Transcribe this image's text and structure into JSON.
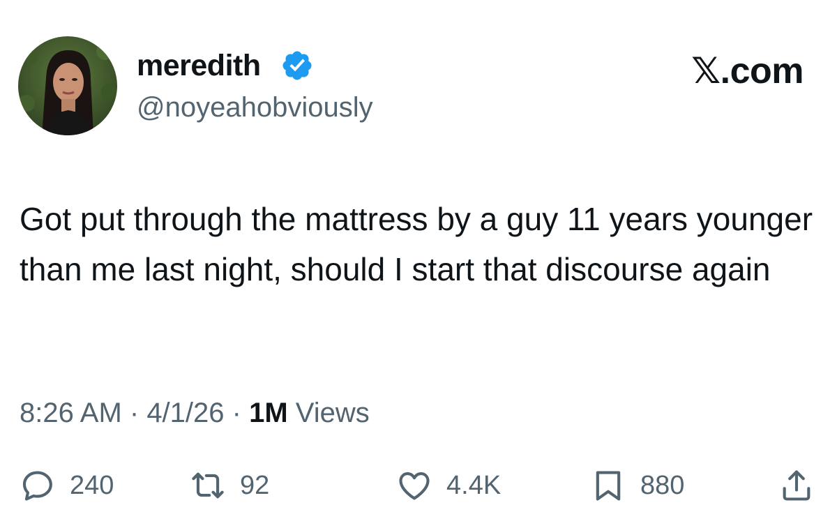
{
  "author": {
    "display_name": "meredith",
    "handle": "@noyeahobviously",
    "verified": true
  },
  "brand": "𝕏.com",
  "tweet": {
    "text": "Got put through the mattress by a guy 11 years younger than me last night, should I start that discourse again"
  },
  "meta": {
    "time": "8:26 AM",
    "separator": " · ",
    "date": "4/1/26",
    "views_count": "1M",
    "views_label": " Views"
  },
  "actions": {
    "replies": "240",
    "reposts": "92",
    "likes": "4.4K",
    "bookmarks": "880"
  },
  "colors": {
    "text": "#0f1419",
    "secondary": "#536471",
    "verified_blue": "#1d9bf0"
  }
}
